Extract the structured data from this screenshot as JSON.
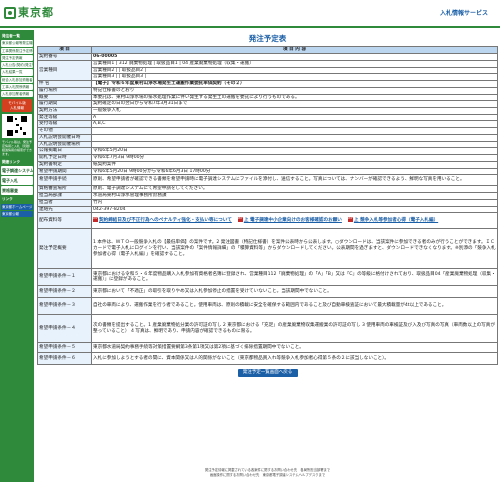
{
  "header": {
    "logo": "東京都",
    "site": "入札情報サービス"
  },
  "sidebar": {
    "menu_title": "発注者一覧",
    "items": [
      "東京都公報等発注機関公表",
      "工事関係発注予定情報",
      "発注予定情報",
      "入札公告(契約)発注情報",
      "入札結果一覧",
      "総合入札参加資格者名簿",
      "工事入札関係情報",
      "入札参加業者情報"
    ],
    "mobile_label": "モバイル版\n入札情報",
    "note": "モバイル版は、発注予定情報と入札（見積）経過情報の検索ができます。",
    "links_title": "関連リンク",
    "links": [
      "電子調達システム(TOP)",
      "電子入札",
      "資格審査"
    ],
    "sub_title": "リンク",
    "sub_links": [
      "東京都ホームページ",
      "東京都公報"
    ]
  },
  "title": "発注予定表",
  "table_header": {
    "c1": "項 目",
    "c2": "項 目 内 容"
  },
  "rows": [
    {
      "label": "契約番号",
      "value": "06-00005"
    },
    {
      "label": "営業種目",
      "value": "営業種目1 | 312 廃棄物処理 | 取扱品目1 | 04 産業廃棄物処理（収集・運搬）"
    },
    {
      "label": "",
      "value": "営業種目2 |  | 取扱品目2 | "
    },
    {
      "label": "",
      "value": "営業種目3 |  | 取扱品目3 | "
    },
    {
      "label": "件 名",
      "value": "【電子】令和６年度東村山浄水場発生土運搬作業委託単価契約（その２）"
    },
    {
      "label": "履行場所",
      "value": "特記仕様書のとおり"
    },
    {
      "label": "概要",
      "value": "本委託は、東村山浄水場の排水処理作業に伴い発生する発生土の運搬を委託により行うものである。"
    },
    {
      "label": "履行期間",
      "value": "契約確定の日の翌日から令和7年3月31日まで"
    },
    {
      "label": "契約方法",
      "value": "一般競争入札"
    },
    {
      "label": "発注等級",
      "value": "A"
    },
    {
      "label": "受付等級",
      "value": "A,B,C"
    },
    {
      "label": "その他",
      "value": ""
    },
    {
      "label": "入札説明会開催日時",
      "value": ""
    },
    {
      "label": "入札説明会開催場所",
      "value": ""
    },
    {
      "label": "公報掲載日",
      "value": "令和6年5月20日"
    },
    {
      "label": "開札予定日時",
      "value": "令和6年7月3日 9時00分"
    },
    {
      "label": "契約書制定",
      "value": "紙契約案件"
    },
    {
      "label": "希望申請期間",
      "value": "令和6年5月20日 9時00分から令和6年6月3日 17時00分"
    }
  ],
  "long_rows": [
    {
      "label": "希望申請手続",
      "value": "原則、希望申請者が確認できる書類を希望申請時に電子調達システムにファイルを添付し、送信すること。写真については、ナンバーが確認できるよう、鮮明な写真を用いること。"
    },
    {
      "label": "資格審査場所",
      "value": "原則、電子調達システムにて希望申請をしてください。"
    },
    {
      "label": "担当局部課",
      "value": "水道局東村山浄水管理事務所庶務課"
    },
    {
      "label": "担当者",
      "value": "竹内"
    },
    {
      "label": "連絡先",
      "value": "042-397-8204"
    }
  ],
  "attachments_label": "配布資料等",
  "attachments": [
    "契約締結日及び不正行為へのペナルティ強化・支払い等について",
    "上 電子調達中小企業向けのお客様確認のお願い",
    "上 競争入札等参加者心得（電子入札編）"
  ],
  "requirements": [
    {
      "label": "発注予定概要",
      "value": "1 本件は、ＷＴＯ一般競争入札の【最低単価】の案件です。2 発注図書（特記仕様書）を案件公表時から公表します。○ダウンロードは、当該案件に参加できる者のみが行うことができます。ＩＣカードで電子入札にログインを行い、当該案件の「案件情報詳細」の「積算資料等」からダウンロードしてください。公表期間を過ぎますと、ダウンロードできなくなります。※別添の「競争入札参加者心得（電子入札編）」を確認すること。"
    },
    {
      "label": "希望申請条件－１",
      "value": "東京都における令和５・６年度物品購入入札参加有資格者名簿に登録され、営業種目112「廃棄物処理」の「A」「B」又は「C」の等級に格付けされており、取扱品目04「産業廃棄物処理（収集・運搬）」に登録があること。"
    },
    {
      "label": "希望申請条件－２",
      "value": "東京都において「不適正」の取引を取りやめ又は入札参加停止の措置を受けていないこと。当該期間中でないこと。"
    },
    {
      "label": "希望申請条件－３",
      "value": "自社の車両により、運搬作業を行う者であること。使用車両は、原則の積載に安全を確保する範囲内であること及び自動車検査証において最大積載量が4t以上であること。"
    },
    {
      "label": "希望申請条件－４",
      "value": "次の書類を提出すること。1 産業廃棄物処分業の許可証の写し 2 東京都における「充足」の産業廃棄物収集運搬業の許可証の写し 3 使用車両の車検証及び入及び写真の写真（車両数以上の写真が整っていること） 4 写真は、鮮明であり、申請内容が確認できるものに限る。"
    },
    {
      "label": "希望申請条件－５",
      "value": "東京都水道局契約事務手続等対策措置要綱第3条第1項又は第2項に基づく排除措置期間中でないこと。"
    },
    {
      "label": "希望申請条件－６",
      "value": "入札に参加しようとする者の間に、資本関係又は人的関係がないこと（東京都物品買入れ等競争入札参加者心得第５条の２に該当しないこと）。"
    }
  ],
  "back_button": "発注予定一覧画面へ戻る",
  "footer": [
    "発注予定情報に掲載されている各案件に関するお問い合わせ先　各局所担当部署まで",
    "画面操作に関するお問い合わせ先　東京都電子調達システムヘルプデスクまで"
  ]
}
